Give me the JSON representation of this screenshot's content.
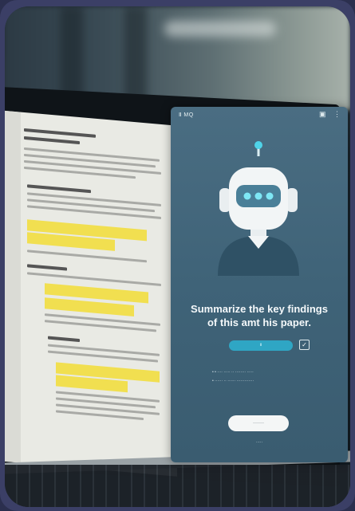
{
  "panel": {
    "title": "Ⅱ MQ",
    "icons": [
      "chat-icon",
      "menu-icon"
    ],
    "question": "Summarize the key findings of this amt his paper.",
    "pill_label": "Ⅱ",
    "check_mark": "✓",
    "bullets": [
      "•  •  ···· ····· ·· ········ ·····",
      "•  ······ ·· ······ ·············"
    ],
    "cta_label": "·······",
    "footer": "·····"
  },
  "colors": {
    "accent": "#2fa6c4",
    "panel": "#4a6d82",
    "highlight": "#f2dd36"
  }
}
